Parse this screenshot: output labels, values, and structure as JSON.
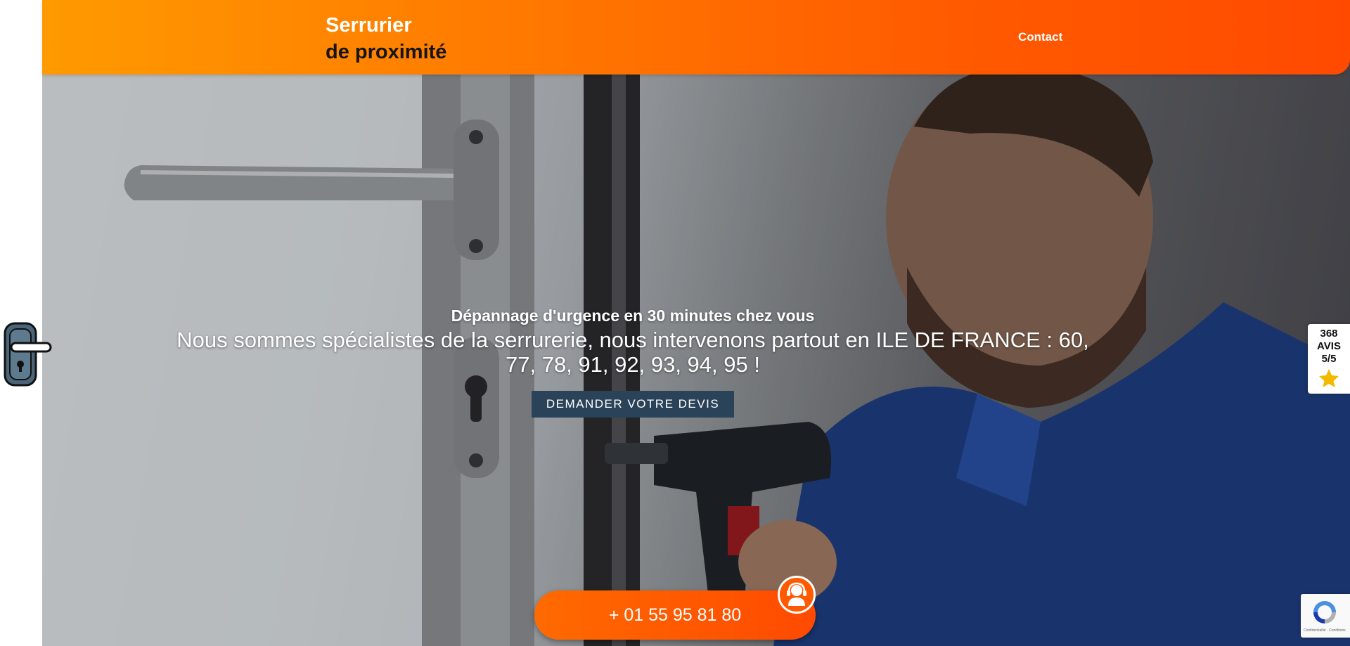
{
  "header": {
    "brand_line1": "Serrurier",
    "brand_line2": "de proximité",
    "nav_contact": "Contact",
    "gradient_colors": [
      "#ff9a00",
      "#ff4a00"
    ]
  },
  "hero": {
    "kicker": "Dépannage d'urgence en 30 minutes chez vous",
    "lead": "Nous sommes spécialistes de la serrurerie, nous intervenons partout en ILE DE FRANCE : 60, 77, 78, 91, 92, 93, 94, 95 !",
    "cta_label": "DEMANDER VOTRE DEVIS",
    "cta_color": "#2b4358"
  },
  "reviews": {
    "count": "368",
    "label": "AVIS",
    "rating": "5/5",
    "icon": "star-icon"
  },
  "phone": {
    "number": "+ 01 55 95 81 80",
    "icon": "support-agent-icon"
  },
  "widgets": {
    "door_handle_icon": "door-handle-icon",
    "recaptcha_text": "Confidentialité - Conditions"
  }
}
